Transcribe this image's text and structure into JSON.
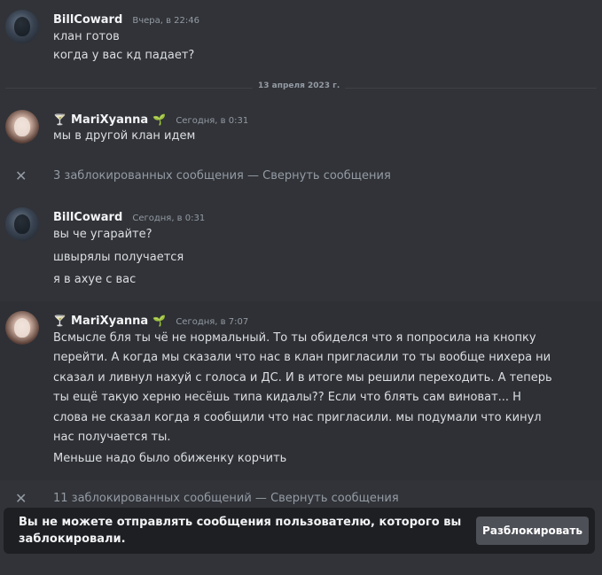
{
  "messages": [
    {
      "author": "BillCoward",
      "time": "Вчера, в 22:46",
      "lines": [
        "клан готов",
        "когда у вас кд падает?"
      ]
    },
    {
      "author": "MariXyanna",
      "time": "Сегодня, в 0:31",
      "lines": [
        "мы в другой клан идем"
      ]
    },
    {
      "author": "BillCoward",
      "time": "Сегодня, в 0:31",
      "lines": [
        "вы че угарайте?",
        "швырялы получается",
        "я в ахуе с вас"
      ]
    },
    {
      "author": "MariXyanna",
      "time": "Сегодня, в 7:07",
      "paragraph": "Всмысле бля ты чё не нормальный. То ты обиделся что я попросила на кнопку перейти. А когда мы сказали что нас в клан пригласили то ты вообще нихера ни сказал и ливнул нахуй с голоса и ДС. И в итоге мы решили переходить. А теперь ты ещё такую херню несёшь типа кидалы?? Если что блять сам виноват... Н слова не сказал когда я сообщили что нас пригласили. мы подумали что кинул нас получается ты.",
      "lines": [
        "Меньше надо было обиженку корчить"
      ]
    }
  ],
  "date_divider": "13 апреля 2023 г.",
  "blocked_groups": [
    {
      "count_text": "3 заблокированных сообщения",
      "separator": "—",
      "action": "Свернуть сообщения"
    },
    {
      "count_text": "11 заблокированных сообщений",
      "separator": "—",
      "action": "Свернуть сообщения"
    }
  ],
  "emojis": {
    "cocktail": "🍸",
    "sprout": "🌱"
  },
  "blocked_bar": {
    "text": "Вы не можете отправлять сообщения пользователю, которого вы заблокировали.",
    "button": "Разблокировать"
  }
}
